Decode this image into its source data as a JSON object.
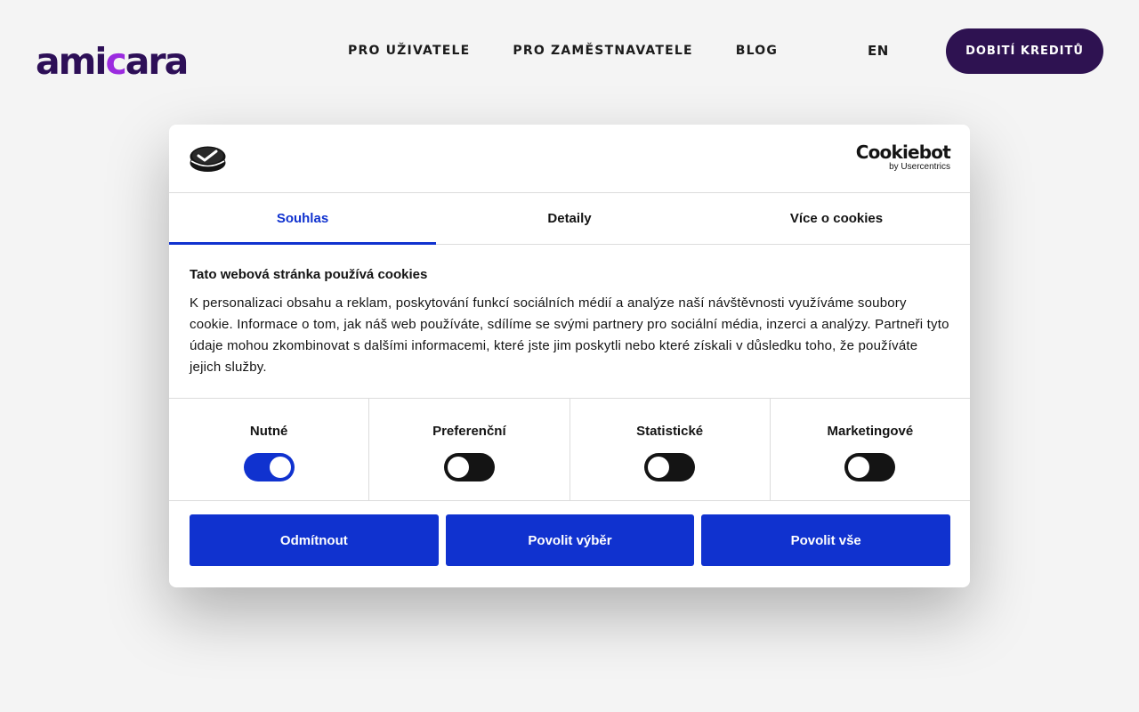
{
  "header": {
    "logo": {
      "part1": "ami",
      "part2": "c",
      "part3": "ara"
    },
    "nav": [
      "PRO UŽIVATELE",
      "PRO ZAMĚSTNAVATELE",
      "BLOG"
    ],
    "lang": "EN",
    "cta_label": "DOBITÍ KREDITŮ"
  },
  "dialog": {
    "brand": "Cookiebot",
    "brand_sub": "by Usercentrics",
    "tabs": [
      {
        "label": "Souhlas",
        "active": true
      },
      {
        "label": "Detaily",
        "active": false
      },
      {
        "label": "Více o cookies",
        "active": false
      }
    ],
    "title": "Tato webová stránka používá cookies",
    "text": "K personalizaci obsahu a reklam, poskytování funkcí sociálních médií a analýze naší návštěvnosti využíváme soubory cookie. Informace o tom, jak náš web používáte, sdílíme se svými partnery pro sociální média, inzerci a analýzy. Partneři tyto údaje mohou zkombinovat s dalšími informacemi, které jste jim poskytli nebo které získali v důsledku toho, že používáte jejich služby.",
    "categories": [
      {
        "label": "Nutné",
        "enabled": true
      },
      {
        "label": "Preferenční",
        "enabled": false
      },
      {
        "label": "Statistické",
        "enabled": false
      },
      {
        "label": "Marketingové",
        "enabled": false
      }
    ],
    "buttons": {
      "decline": "Odmítnout",
      "allow_selection": "Povolit výběr",
      "allow_all": "Povolit vše"
    },
    "colors": {
      "accent": "#1032cf",
      "brand_dark": "#2e1251",
      "logo_accent": "#9b2bdf"
    }
  }
}
